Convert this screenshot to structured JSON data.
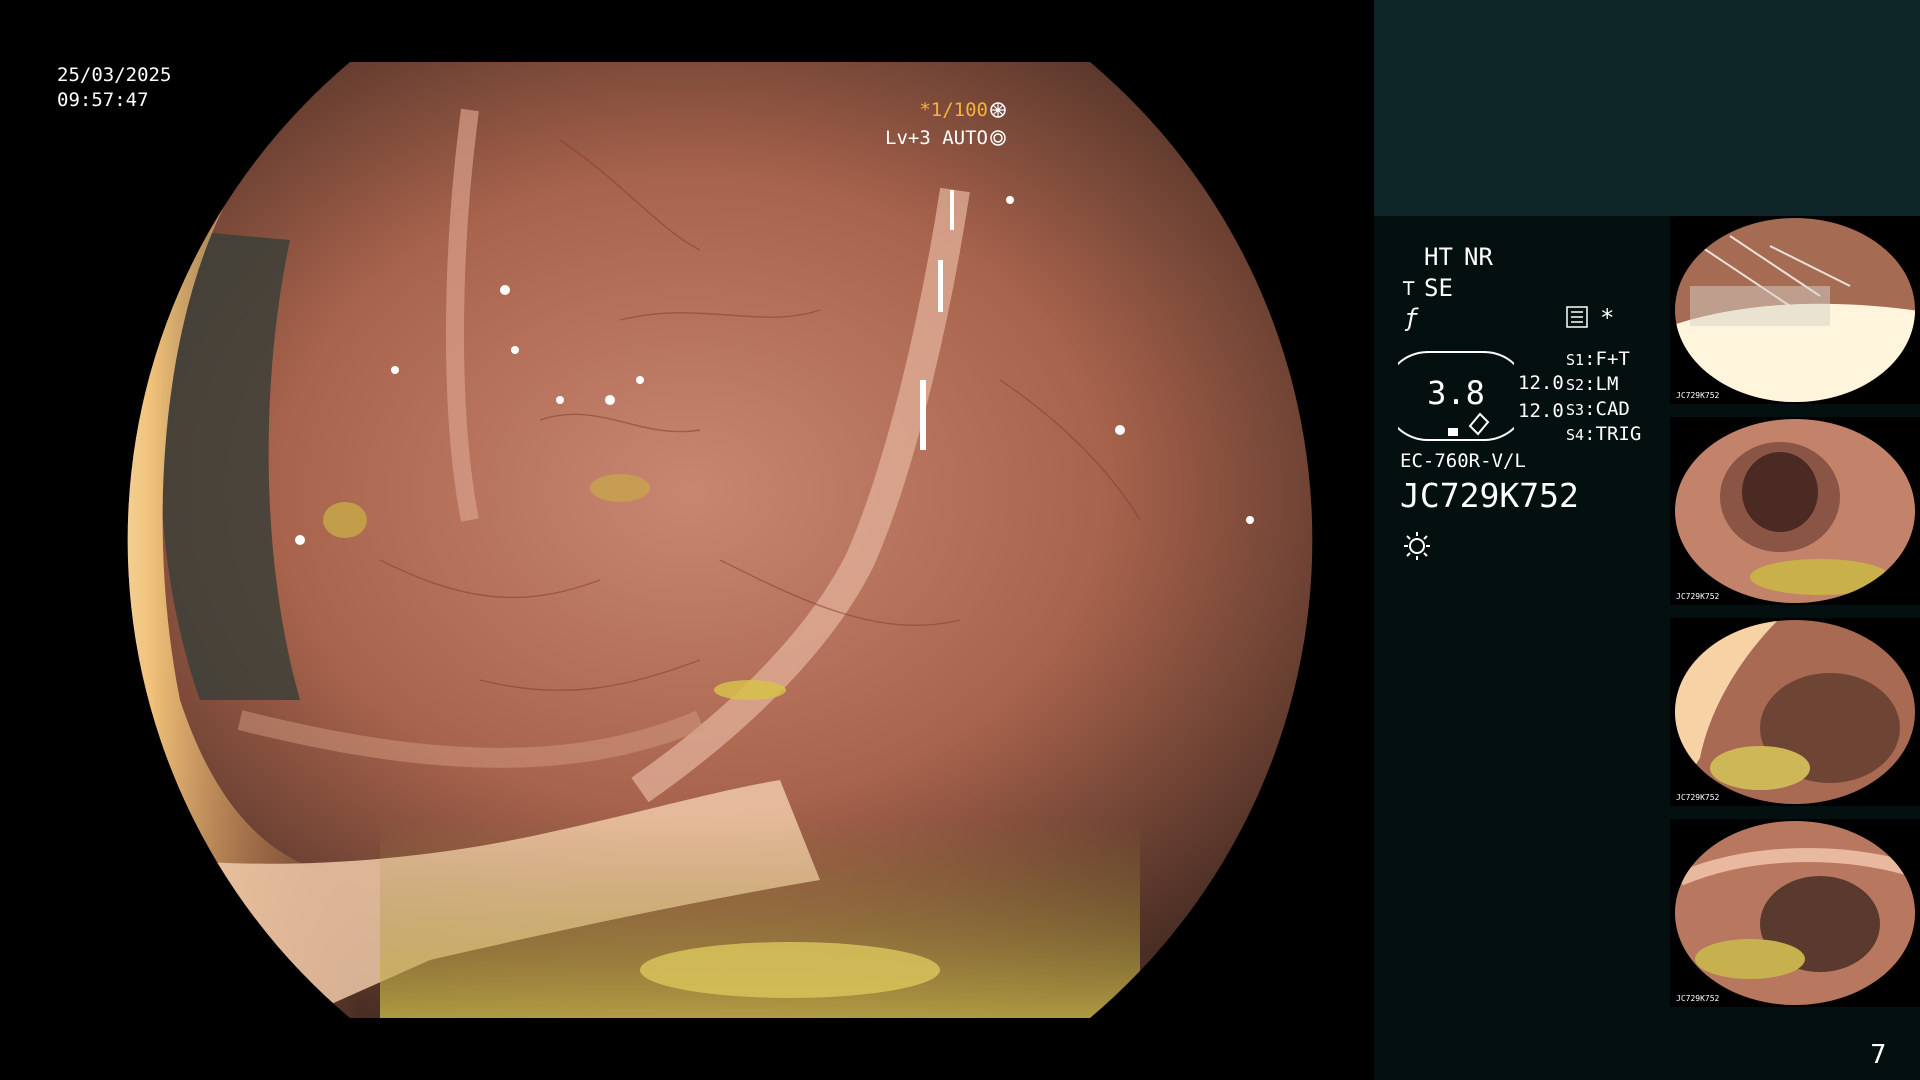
{
  "overlay": {
    "date": "25/03/2025",
    "time": "09:57:47",
    "shutter_prefix": "*",
    "shutter": "1/100",
    "level": "Lv+3",
    "mode": "AUTO"
  },
  "panel": {
    "mode_ht": "HT",
    "mode_nr": "NR",
    "mode_se": "SE",
    "asterisk": "*",
    "gauge_value": "3.8",
    "value_a": "12.0",
    "value_b": "12.0",
    "switches": [
      {
        "key": "S1",
        "value": "F+T"
      },
      {
        "key": "S2",
        "value": "LM"
      },
      {
        "key": "S3",
        "value": "CAD"
      },
      {
        "key": "S4",
        "value": "TRIG"
      }
    ],
    "scope_model": "EC-760R-V/L",
    "scope_serial": "JC729K752"
  },
  "thumbnails": [
    {
      "label": "JC729K752"
    },
    {
      "label": "JC729K752"
    },
    {
      "label": "JC729K752"
    },
    {
      "label": "JC729K752"
    }
  ],
  "page_number": "7",
  "colors": {
    "accent": "#f5b23a",
    "panel_top": "#0d2526",
    "panel_bg": "#04100f"
  }
}
